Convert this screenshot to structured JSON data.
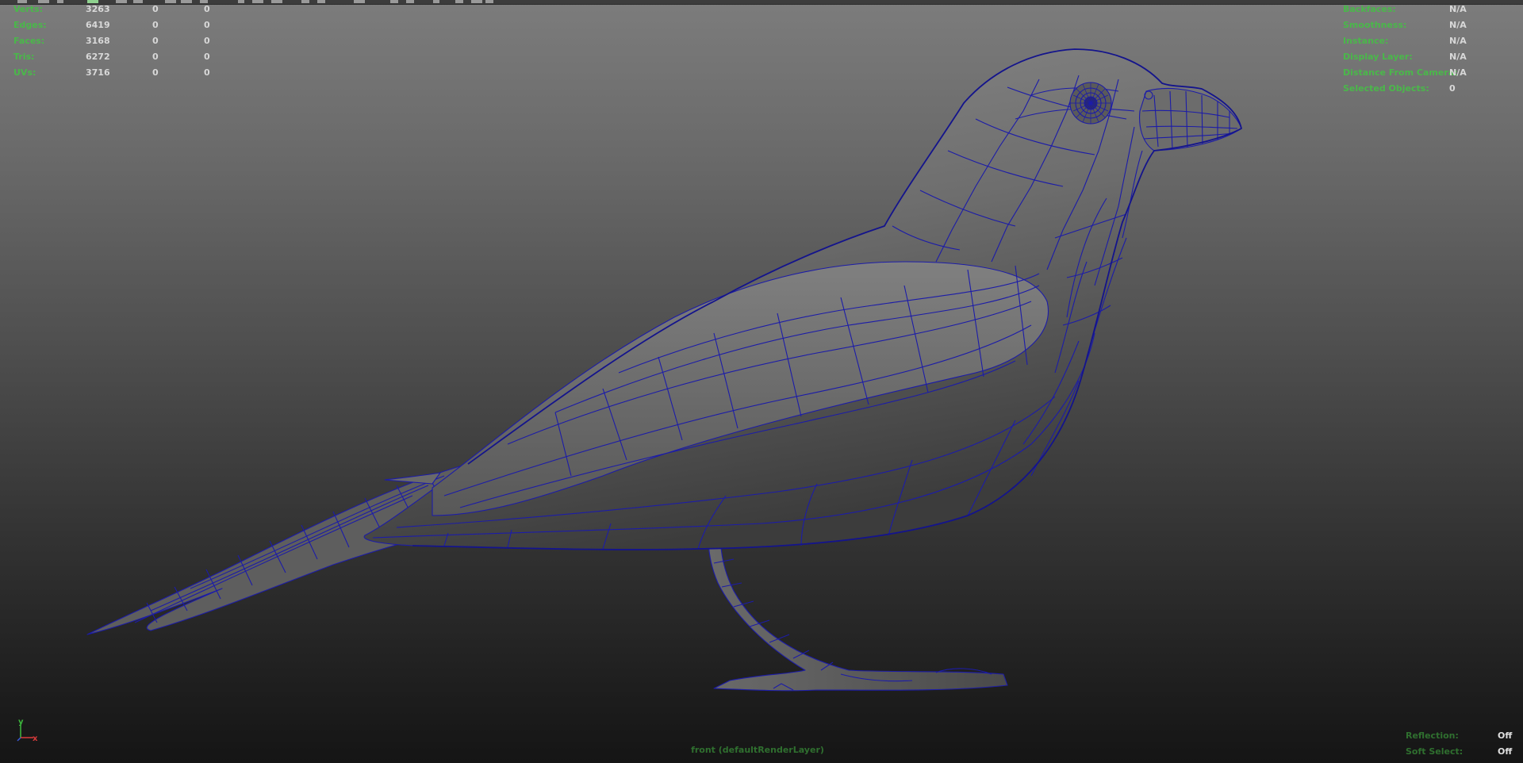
{
  "viewport": {
    "camera_label": "front (defaultRenderLayer)",
    "wire_color": "#1c1ca8",
    "hud_label_color": "#4ab84a"
  },
  "poly_count": [
    {
      "label": "Verts:",
      "v1": "3263",
      "v2": "0",
      "v3": "0"
    },
    {
      "label": "Edges:",
      "v1": "6419",
      "v2": "0",
      "v3": "0"
    },
    {
      "label": "Faces:",
      "v1": "3168",
      "v2": "0",
      "v3": "0"
    },
    {
      "label": "Tris:",
      "v1": "6272",
      "v2": "0",
      "v3": "0"
    },
    {
      "label": "UVs:",
      "v1": "3716",
      "v2": "0",
      "v3": "0"
    }
  ],
  "object_details": [
    {
      "label": "Backfaces:",
      "value": "N/A"
    },
    {
      "label": "Smoothness:",
      "value": "N/A"
    },
    {
      "label": "Instance:",
      "value": "N/A"
    },
    {
      "label": "Display Layer:",
      "value": "N/A"
    },
    {
      "label": "Distance From Camera:",
      "value": "N/A"
    },
    {
      "label": "Selected Objects:",
      "value": "0"
    }
  ],
  "status": [
    {
      "label": "Reflection:",
      "value": "Off"
    },
    {
      "label": "Soft Select:",
      "value": "Off"
    }
  ],
  "axis": {
    "y": "y",
    "x": "x"
  },
  "icons": {
    "axis_gizmo": "axis-gizmo-icon",
    "toolbar": "viewport-toolbar-icons"
  }
}
